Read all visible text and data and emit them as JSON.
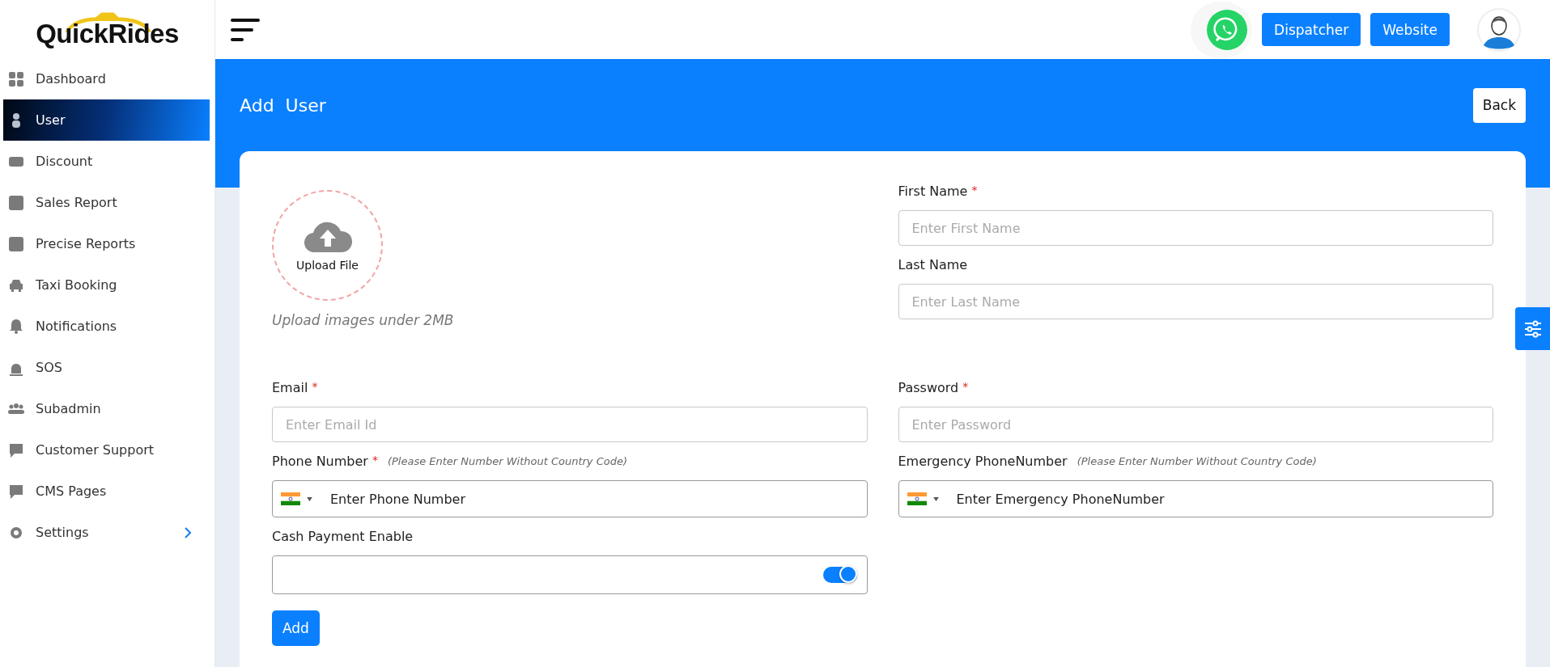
{
  "logo": {
    "text": "QuickRides"
  },
  "sidebar": {
    "items": [
      {
        "label": "Dashboard",
        "selected": false
      },
      {
        "label": "User",
        "selected": true
      },
      {
        "label": "Discount",
        "selected": false
      },
      {
        "label": "Sales Report",
        "selected": false
      },
      {
        "label": "Precise Reports",
        "selected": false
      },
      {
        "label": "Taxi Booking",
        "selected": false
      },
      {
        "label": "Notifications",
        "selected": false
      },
      {
        "label": "SOS",
        "selected": false
      },
      {
        "label": "Subadmin",
        "selected": false
      },
      {
        "label": "Customer Support",
        "selected": false
      },
      {
        "label": "CMS Pages",
        "selected": false
      },
      {
        "label": "Settings",
        "selected": false,
        "expandable": true
      }
    ]
  },
  "header": {
    "buttons": [
      "Dispatcher",
      "Website"
    ]
  },
  "page": {
    "title": "Add  User",
    "back_button": "Back"
  },
  "upload": {
    "label": "Upload File",
    "hint": "Upload images under 2MB"
  },
  "name_fields": [
    {
      "label": "First Name",
      "required_mark": "*",
      "placeholder": "Enter First Name"
    },
    {
      "label": "Last Name",
      "placeholder": "Enter Last Name"
    }
  ],
  "fields": [
    {
      "kind": "text",
      "label": "Email",
      "required_mark": "*",
      "placeholder": "Enter Email Id"
    },
    {
      "kind": "text",
      "label": "Password",
      "required_mark": "*",
      "placeholder": "Enter Password"
    },
    {
      "kind": "phone",
      "label": "Phone Number",
      "required_mark": "*",
      "note": "(Please Enter Number Without Country Code)",
      "placeholder": "Enter Phone Number"
    },
    {
      "kind": "phone",
      "label": "Emergency PhoneNumber",
      "note": "(Please Enter Number Without Country Code)",
      "placeholder": "Enter Emergency PhoneNumber"
    },
    {
      "kind": "toggle",
      "label": "Cash Payment Enable",
      "on": true
    }
  ],
  "submit_button": "Add"
}
